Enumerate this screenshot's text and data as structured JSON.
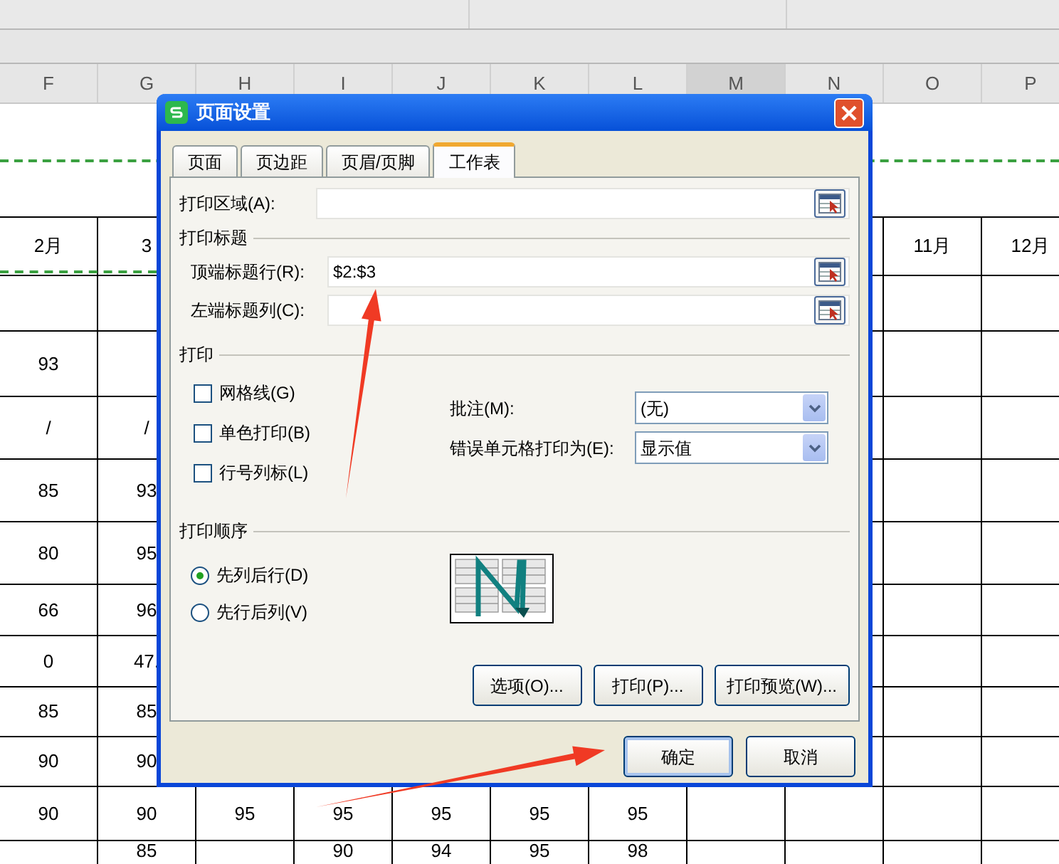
{
  "column_headers": [
    {
      "label": "F",
      "selected": false
    },
    {
      "label": "G",
      "selected": false
    },
    {
      "label": "H",
      "selected": false
    },
    {
      "label": "I",
      "selected": false
    },
    {
      "label": "J",
      "selected": false
    },
    {
      "label": "K",
      "selected": false
    },
    {
      "label": "L",
      "selected": false
    },
    {
      "label": "M",
      "selected": true
    },
    {
      "label": "N",
      "selected": false
    },
    {
      "label": "O",
      "selected": false
    },
    {
      "label": "P",
      "selected": false
    }
  ],
  "rows": [
    {
      "kind": "page-header"
    },
    {
      "kind": "cells",
      "cells": {
        "F": "2月",
        "G": "3",
        "O": "11月",
        "P": "12月"
      }
    },
    {
      "kind": "cells"
    },
    {
      "kind": "cells",
      "cells": {
        "F": "93"
      }
    },
    {
      "kind": "cells",
      "cells": {
        "F": "/",
        "G": "/"
      }
    },
    {
      "kind": "cells",
      "cells": {
        "F": "85",
        "G": "93"
      }
    },
    {
      "kind": "cells",
      "cells": {
        "F": "80",
        "G": "95"
      }
    },
    {
      "kind": "cells",
      "cells": {
        "F": "66",
        "G": "96"
      }
    },
    {
      "kind": "cells",
      "cells": {
        "F": "0",
        "G": "47."
      }
    },
    {
      "kind": "cells",
      "cells": {
        "F": "85",
        "G": "85"
      }
    },
    {
      "kind": "cells",
      "cells": {
        "F": "90",
        "G": "90"
      }
    },
    {
      "kind": "cells",
      "cells": {
        "F": "90",
        "G": "90",
        "H": "95",
        "I": "95",
        "J": "95",
        "K": "95",
        "L": "95"
      }
    },
    {
      "kind": "cells",
      "cells": {
        "G": "85",
        "I": "90",
        "J": "94",
        "K": "95",
        "L": "98"
      }
    }
  ],
  "dialog": {
    "title": "页面设置",
    "tabs": [
      {
        "label": "页面",
        "selected": false
      },
      {
        "label": "页边距",
        "selected": false
      },
      {
        "label": "页眉/页脚",
        "selected": false
      },
      {
        "label": "工作表",
        "selected": true
      }
    ],
    "print_area": {
      "label": "打印区域(A):"
    },
    "title_section": {
      "heading": "打印标题",
      "fields": [
        {
          "label": "顶端标题行(R):",
          "value": "$2:$3"
        },
        {
          "label": "左端标题列(C):"
        }
      ]
    },
    "print_section": {
      "heading": "打印",
      "checkboxes": [
        {
          "label": "网格线(G)",
          "checked": false
        },
        {
          "label": "单色打印(B)",
          "checked": false
        },
        {
          "label": "行号列标(L)",
          "checked": false
        }
      ],
      "dropdowns": [
        {
          "label": "批注(M):",
          "value": "(无)"
        },
        {
          "label": "错误单元格打印为(E):",
          "value": "显示值"
        }
      ]
    },
    "order_section": {
      "heading": "打印顺序",
      "radios": [
        {
          "label": "先列后行(D)",
          "selected": true
        },
        {
          "label": "先行后列(V)",
          "selected": false
        }
      ]
    },
    "sheet_buttons": [
      "选项(O)...",
      "打印(P)...",
      "打印预览(W)..."
    ],
    "buttons": [
      {
        "label": "确定",
        "default": true
      },
      {
        "label": "取消",
        "default": false
      }
    ]
  }
}
